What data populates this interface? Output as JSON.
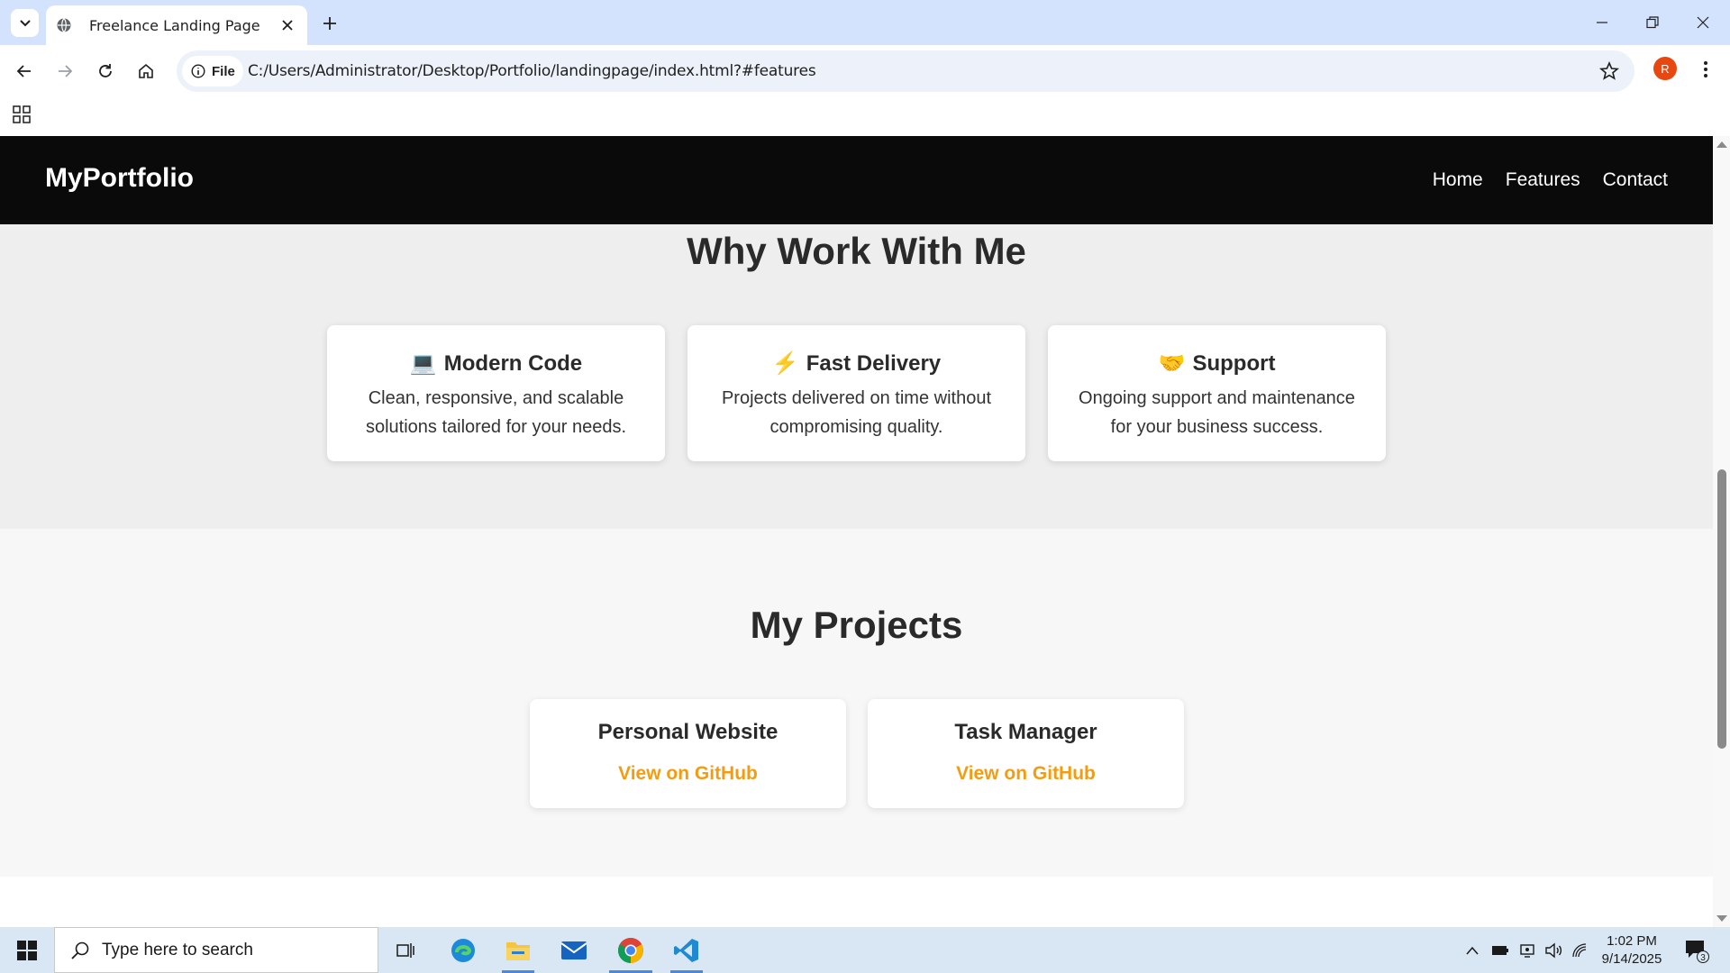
{
  "browser": {
    "tab_title": "Freelance Landing Page",
    "url_chip": "File",
    "url": "C:/Users/Administrator/Desktop/Portfolio/landingpage/index.html?#features",
    "profile_initial": "R"
  },
  "site": {
    "brand": "MyPortfolio",
    "nav": [
      "Home",
      "Features",
      "Contact"
    ],
    "features": {
      "heading": "Why Work With Me",
      "cards": [
        {
          "emoji": "💻",
          "title": "Modern Code",
          "text": "Clean, responsive, and scalable solutions tailored for your needs."
        },
        {
          "emoji": "⚡",
          "title": "Fast Delivery",
          "text": "Projects delivered on time without compromising quality."
        },
        {
          "emoji": "🤝",
          "title": "Support",
          "text": "Ongoing support and maintenance for your business success."
        }
      ]
    },
    "projects": {
      "heading": "My Projects",
      "items": [
        {
          "title": "Personal Website",
          "link": "View on GitHub"
        },
        {
          "title": "Task Manager",
          "link": "View on GitHub"
        }
      ]
    }
  },
  "taskbar": {
    "search_placeholder": "Type here to search",
    "time": "1:02 PM",
    "date": "9/14/2025",
    "notification_count": "3"
  },
  "colors": {
    "accent_link": "#f39c12",
    "nav_bg": "#0a0a0a",
    "tabstrip_bg": "#d3e3fd"
  }
}
